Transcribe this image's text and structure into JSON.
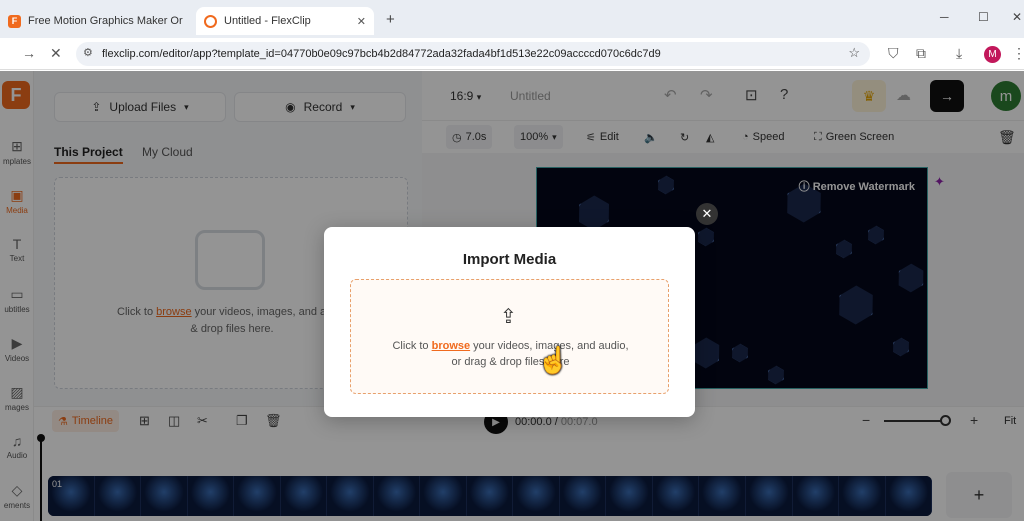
{
  "browser": {
    "tabs": [
      {
        "label": "Free Motion Graphics Maker Or",
        "close": "✕"
      },
      {
        "label": "Untitled - FlexClip",
        "close": "✕"
      }
    ],
    "new_tab": "+",
    "url": "flexclip.com/editor/app?template_id=04770b0e09c97bcb4b2d84772ada32fada4bf1d513e22c09accccd070c6dc7d9",
    "profile_initial": "M",
    "window_controls": [
      "─",
      "☐",
      "✕"
    ]
  },
  "leftnav": {
    "items": [
      {
        "label": "mplates",
        "icon": "templates-icon"
      },
      {
        "label": "Media",
        "icon": "media-icon"
      },
      {
        "label": "Text",
        "icon": "text-icon"
      },
      {
        "label": "ubtitles",
        "icon": "subtitles-icon"
      },
      {
        "label": "Videos",
        "icon": "videos-icon"
      },
      {
        "label": "mages",
        "icon": "images-icon"
      },
      {
        "label": "Audio",
        "icon": "audio-icon"
      },
      {
        "label": "ements",
        "icon": "elements-icon"
      }
    ]
  },
  "panel": {
    "upload_label": "Upload Files",
    "record_label": "Record",
    "tabs": [
      "This Project",
      "My Cloud"
    ],
    "drop_text_prefix": "Click to ",
    "drop_link": "browse",
    "drop_text_suffix": " your videos, images, and audio",
    "drop_text_line2": "& drop files here."
  },
  "editor": {
    "aspect": "16:9",
    "title": "Untitled",
    "avatar": "m",
    "duration": "7.0s",
    "zoom": "100%",
    "edit": "Edit",
    "speed": "Speed",
    "green_screen": "Green Screen",
    "remove_watermark": "Remove Watermark"
  },
  "timeline": {
    "label": "Timeline",
    "time_current": "00:00.0",
    "time_total": "00:07.0",
    "fit": "Fit",
    "clip_index": "01",
    "add": "+"
  },
  "modal": {
    "title": "Import Media",
    "text_prefix": "Click to ",
    "link": "browse",
    "text_suffix": " your videos, images, and audio,",
    "line2": "or drag & drop files here"
  },
  "colors": {
    "accent": "#f06a1e",
    "canvas_bg": "#05081a",
    "overlay": "rgba(0,0,0,0.42)"
  }
}
